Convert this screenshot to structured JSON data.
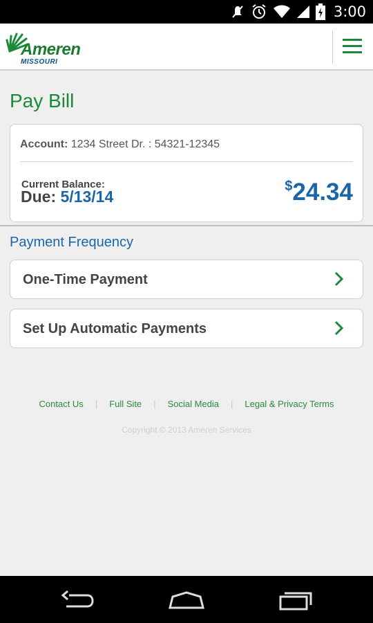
{
  "status_bar": {
    "time": "3:00"
  },
  "header": {
    "brand": "Ameren",
    "sub_brand": "MISSOURI"
  },
  "page": {
    "title": "Pay Bill"
  },
  "account": {
    "label": "Account:",
    "value": "1234 Street Dr. : 54321-12345",
    "balance_label": "Current Balance:",
    "due_label": "Due:",
    "due_date": "5/13/14",
    "currency_symbol": "$",
    "amount": "24.34"
  },
  "payment": {
    "section_title": "Payment Frequency",
    "options": [
      {
        "label": "One-Time Payment"
      },
      {
        "label": "Set Up Automatic Payments"
      }
    ]
  },
  "footer": {
    "links": [
      "Contact Us",
      "Full Site",
      "Social Media",
      "Legal & Privacy Terms"
    ],
    "separator": "|",
    "copyright": "Copyright © 2013 Ameren Services"
  },
  "colors": {
    "brand_green": "#1a8a3a",
    "brand_blue": "#1b66a8"
  }
}
